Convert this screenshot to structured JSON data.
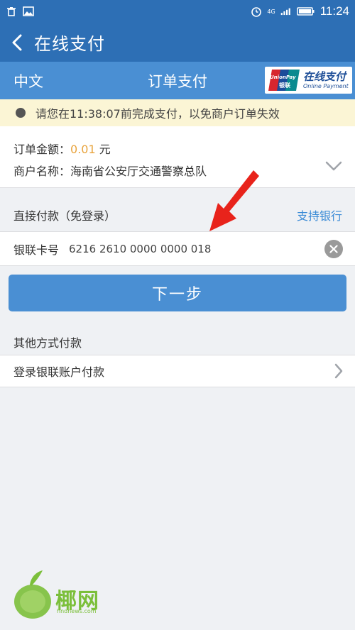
{
  "status_bar": {
    "time": "11:24",
    "network": "4G",
    "icons": [
      "trash-icon",
      "image-icon",
      "alarm-icon",
      "signal-icon",
      "battery-icon"
    ]
  },
  "app_bar": {
    "title": "在线支付",
    "back_icon": "chevron-left-icon"
  },
  "pay_header": {
    "language": "中文",
    "title": "订单支付",
    "logo": {
      "brand": "UnionPay",
      "brand_cn": "银联",
      "text_cn": "在线支付",
      "text_en": "Online Payment"
    }
  },
  "notice": {
    "text": "请您在11:38:07前完成支付，以免商户订单失效"
  },
  "order": {
    "amount_label": "订单金额：",
    "amount_value": "0.01",
    "amount_unit": "元",
    "merchant_label": "商户名称：",
    "merchant_value": "海南省公安厅交通警察总队"
  },
  "direct_pay": {
    "label": "直接付款（免登录）",
    "supported_banks": "支持银行",
    "card_label": "银联卡号",
    "card_number": "6216 2610 0000 0000 018"
  },
  "next_button": "下一步",
  "other_pay": {
    "label": "其他方式付款",
    "login_option": "登录银联账户付款"
  },
  "watermark": {
    "text": "椰网",
    "sub": "hndnews.com"
  },
  "colors": {
    "primary": "#2d6fb5",
    "header": "#4a8fd3",
    "notice_bg": "#fbf5d5",
    "amount": "#e8a33c",
    "link": "#3b8bd6",
    "annotation": "#e8231b"
  }
}
